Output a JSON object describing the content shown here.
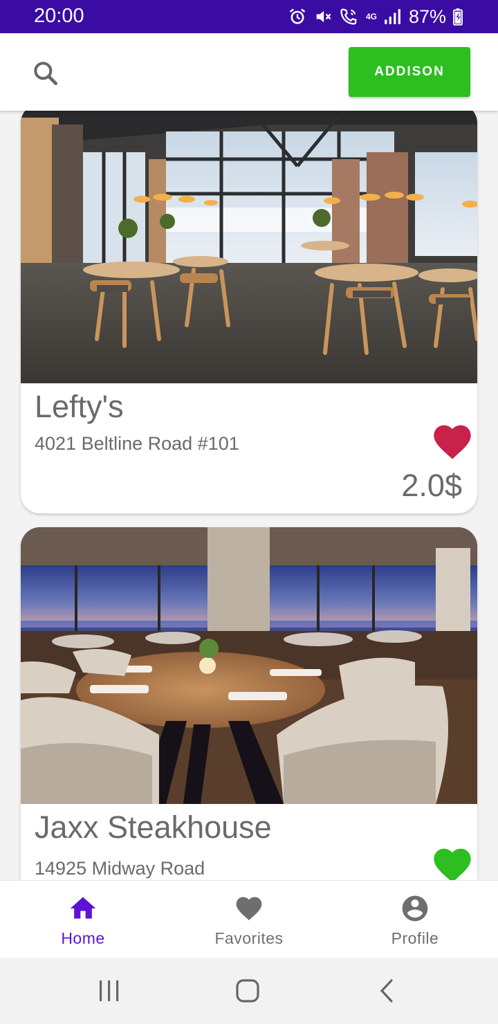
{
  "status_bar": {
    "time": "20:00",
    "network": "4G",
    "battery": "87%",
    "icons": [
      "alarm-icon",
      "mute-icon",
      "wifi-calling-icon",
      "signal-icon",
      "battery-charging-icon"
    ]
  },
  "header": {
    "search_icon": "search-icon",
    "user_button_label": "ADDISON"
  },
  "restaurants": [
    {
      "name": "Lefty's",
      "address": "4021 Beltline Road #101",
      "price": "2.0$",
      "favorite_color": "#c8214a"
    },
    {
      "name": "Jaxx Steakhouse",
      "address": "14925 Midway Road",
      "favorite_color": "#2cbf1f"
    }
  ],
  "bottom_nav": {
    "items": [
      {
        "label": "Home",
        "icon": "home-icon",
        "active": true
      },
      {
        "label": "Favorites",
        "icon": "heart-icon",
        "active": false
      },
      {
        "label": "Profile",
        "icon": "account-circle-icon",
        "active": false
      }
    ]
  },
  "system_nav": {
    "icons": [
      "recents-icon",
      "home-circle-icon",
      "back-icon"
    ]
  },
  "colors": {
    "status_bar": "#3a0ca3",
    "accent": "#5d13d4",
    "user_button": "#2cbf1f",
    "favorite_on": "#c8214a",
    "favorite_green": "#2cbf1f"
  }
}
